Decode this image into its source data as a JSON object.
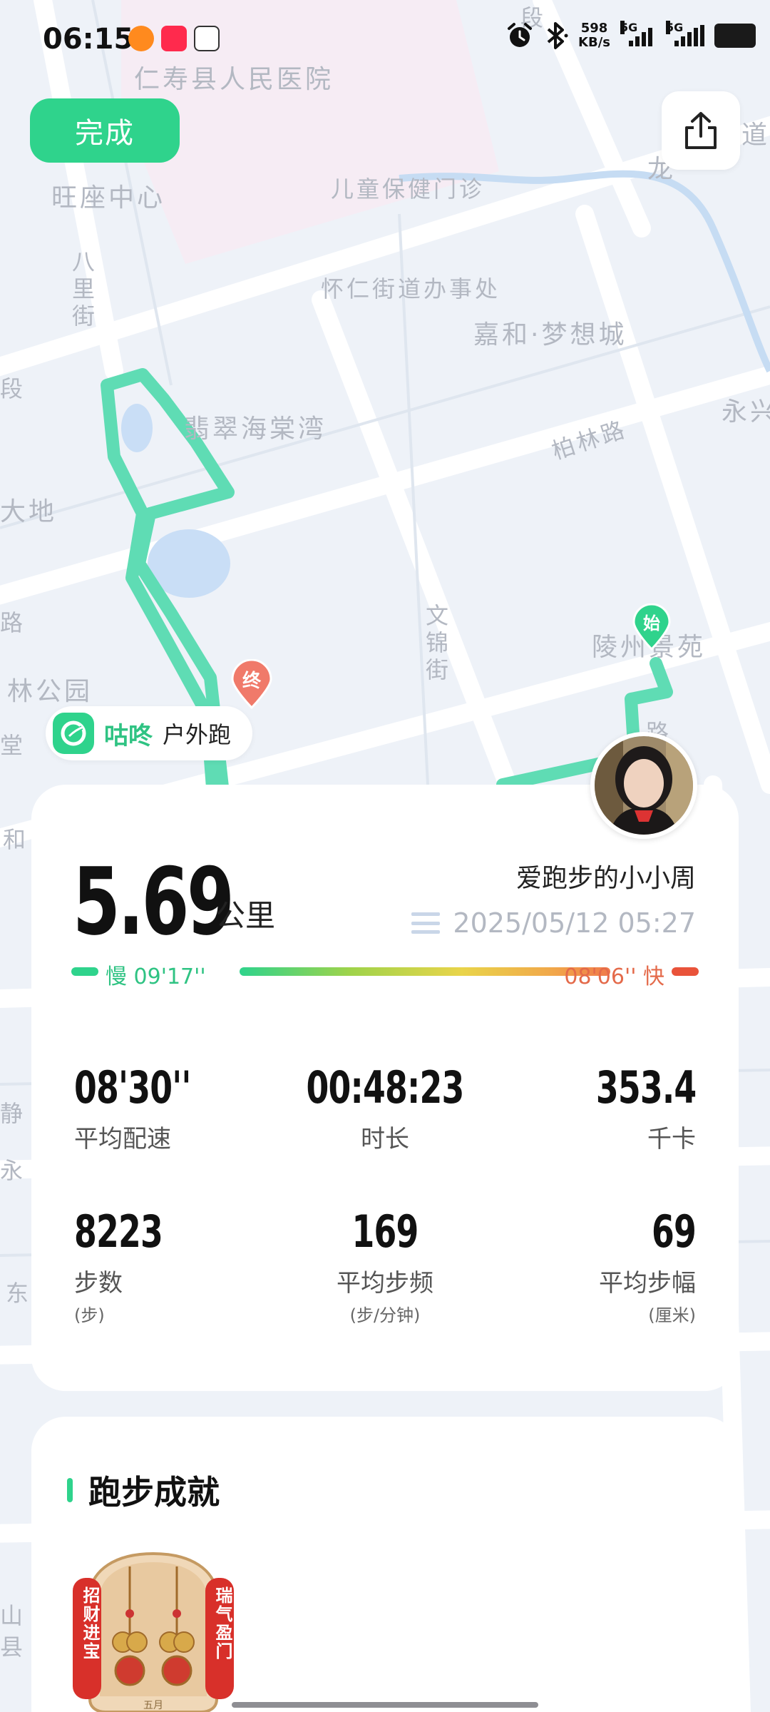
{
  "status_bar": {
    "time": "06:15",
    "net_speed_value": "598",
    "net_speed_unit": "KB/s",
    "sim1": "5G",
    "sim2": "5G"
  },
  "toolbar": {
    "done_label": "完成"
  },
  "map": {
    "labels": {
      "hospital": "仁寿县人民医院",
      "wangzuo": "旺座中心",
      "children_clinic": "儿童保健门诊",
      "huairen_office": "怀仁街道办事处",
      "jiahe": "嘉和·梦想城",
      "bali_street": "八里街",
      "feicui": "翡翠海棠湾",
      "bolin_road": "柏林路",
      "dadi": "大地",
      "wenjin_street": "文锦街",
      "lingzhou": "陵州景苑",
      "linpark": "林公园",
      "duan_top": "段",
      "duan_left": "段",
      "long": "龙",
      "dao": "道",
      "yong_right": "永兴",
      "lu_left": "路",
      "tang": "堂",
      "he": "和",
      "jing": "静",
      "yong": "永",
      "dong": "东",
      "shan": "山",
      "xian": "县",
      "lu_route": "路"
    },
    "start_marker": "始",
    "end_marker": "终"
  },
  "brand": {
    "name": "咕咚",
    "subtitle": "户外跑"
  },
  "summary": {
    "distance": "5.69",
    "distance_unit": "公里",
    "username": "爱跑步的小小周",
    "datetime": "2025/05/12 05:27",
    "pace_slow": "慢 09'17''",
    "pace_fast": "08'06'' 快"
  },
  "metrics": {
    "avg_pace": {
      "value": "08'30''",
      "label": "平均配速"
    },
    "duration": {
      "value": "00:48:23",
      "label": "时长"
    },
    "calories": {
      "value": "353.4",
      "label": "千卡"
    },
    "steps": {
      "value": "8223",
      "label": "步数",
      "unit": "(步)"
    },
    "cadence": {
      "value": "169",
      "label": "平均步频",
      "unit": "(步/分钟)"
    },
    "stride": {
      "value": "69",
      "label": "平均步幅",
      "unit": "(厘米)"
    }
  },
  "achievements": {
    "title": "跑步成就",
    "medal_left_text": "招财进宝",
    "medal_right_text": "瑞气盈门",
    "medal_bottom_text": "五月"
  },
  "colors": {
    "accent_green": "#2fd38c",
    "route_green": "#5fdcb4",
    "slow_color": "#2fc383",
    "fast_color": "#e46a4a"
  }
}
